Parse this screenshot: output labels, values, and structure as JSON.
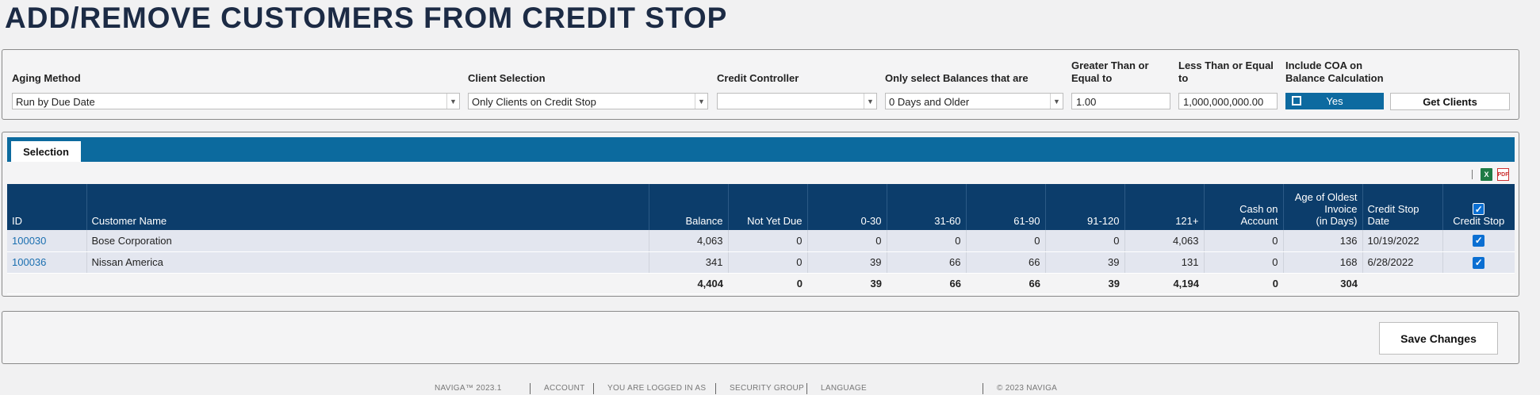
{
  "page": {
    "title": "ADD/REMOVE CUSTOMERS FROM CREDIT STOP"
  },
  "filters": {
    "aging_method": {
      "label": "Aging Method",
      "value": "Run by Due Date"
    },
    "client_selection": {
      "label": "Client Selection",
      "value": "Only Clients on Credit Stop"
    },
    "credit_controller": {
      "label": "Credit Controller",
      "value": ""
    },
    "balance_select": {
      "label": "Only select Balances that are",
      "value": "0 Days and Older"
    },
    "greater_than": {
      "label": "Greater Than or Equal to",
      "value": "1.00"
    },
    "less_than": {
      "label": "Less Than or Equal to",
      "value": "1,000,000,000.00"
    },
    "include_coa": {
      "label": "Include COA on Balance Calculation",
      "value": "Yes"
    },
    "get_clients_label": "Get Clients"
  },
  "tabs": [
    {
      "label": "Selection"
    }
  ],
  "export": {
    "xls_icon": "excel-icon",
    "pdf_icon": "pdf-icon",
    "xls_text": "X",
    "pdf_text": "PDF"
  },
  "table": {
    "columns": [
      "ID",
      "Customer Name",
      "Balance",
      "Not Yet Due",
      "0-30",
      "31-60",
      "61-90",
      "91-120",
      "121+",
      "Cash on Account",
      "Age of Oldest Invoice (in Days)",
      "Credit Stop Date",
      "Credit Stop"
    ],
    "col_head": {
      "cash1": "Cash on",
      "cash2": "Account",
      "age1": "Age of Oldest",
      "age2": "Invoice",
      "age3": "(in Days)",
      "csd1": "Credit Stop",
      "csd2": "Date"
    },
    "rows": [
      {
        "id": "100030",
        "name": "Bose Corporation",
        "balance": "4,063",
        "not_yet_due": "0",
        "d0_30": "0",
        "d31_60": "0",
        "d61_90": "0",
        "d91_120": "0",
        "d121": "4,063",
        "cash": "0",
        "age": "136",
        "stop_date": "10/19/2022",
        "credit_stop": true
      },
      {
        "id": "100036",
        "name": "Nissan America",
        "balance": "341",
        "not_yet_due": "0",
        "d0_30": "39",
        "d31_60": "66",
        "d61_90": "66",
        "d91_120": "39",
        "d121": "131",
        "cash": "0",
        "age": "168",
        "stop_date": "6/28/2022",
        "credit_stop": true
      }
    ],
    "totals": {
      "balance": "4,404",
      "not_yet_due": "0",
      "d0_30": "39",
      "d31_60": "66",
      "d61_90": "66",
      "d91_120": "39",
      "d121": "4,194",
      "cash": "0",
      "age": "304"
    }
  },
  "actions": {
    "save_label": "Save Changes"
  },
  "footer": {
    "version": "NAVIGA™ 2023.1",
    "account": "ACCOUNT",
    "logged_in": "YOU ARE LOGGED IN AS",
    "security_group": "SECURITY GROUP",
    "language": "LANGUAGE",
    "copyright": "© 2023 NAVIGA"
  },
  "colors": {
    "header_blue": "#0c3d6b",
    "tab_bar_blue": "#0c6a9e",
    "link": "#1b6fb0"
  }
}
